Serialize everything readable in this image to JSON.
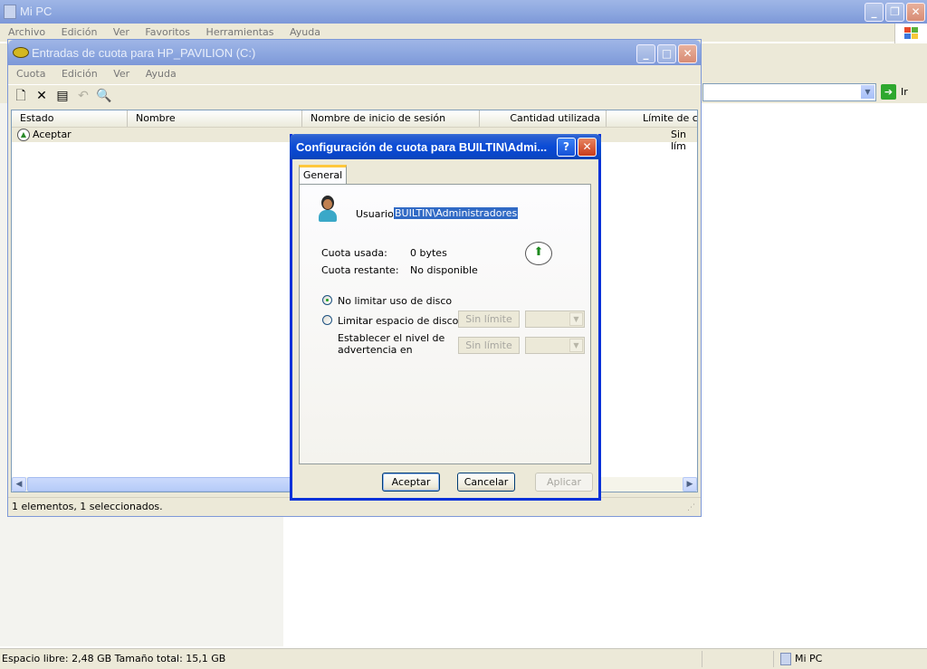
{
  "main_window": {
    "title": "Mi PC",
    "menu": [
      "Archivo",
      "Edición",
      "Ver",
      "Favoritos",
      "Herramientas",
      "Ayuda"
    ],
    "go_label": "Ir",
    "status_left": "Espacio libre: 2,48 GB Tamaño total: 15,1 GB",
    "status_right": "Mi PC"
  },
  "quota_window": {
    "title": "Entradas de cuota para HP_PAVILION (C:)",
    "menu": [
      "Cuota",
      "Edición",
      "Ver",
      "Ayuda"
    ],
    "columns": [
      "Estado",
      "Nombre",
      "Nombre de inicio de sesión",
      "Cantidad utilizada",
      "Límite de cu"
    ],
    "row": {
      "estado": "Aceptar",
      "limite": "Sin lím"
    },
    "status": "1 elementos, 1 seleccionados."
  },
  "dialog": {
    "title": "Configuración de cuota para BUILTIN\\Admi...",
    "tab": "General",
    "user_label": "Usuario:",
    "user_value": "BUILTIN\\Administradores",
    "used_label": "Cuota usada:",
    "used_value": "0 bytes",
    "remaining_label": "Cuota restante:",
    "remaining_value": "No disponible",
    "opt_nolimit": "No limitar uso de disco",
    "opt_limit": "Limitar espacio de disco a",
    "warn_label_1": "Establecer el nivel de",
    "warn_label_2": "advertencia en",
    "limit_field": "Sin límite",
    "warn_field": "Sin límite",
    "btn_ok": "Aceptar",
    "btn_cancel": "Cancelar",
    "btn_apply": "Aplicar"
  }
}
